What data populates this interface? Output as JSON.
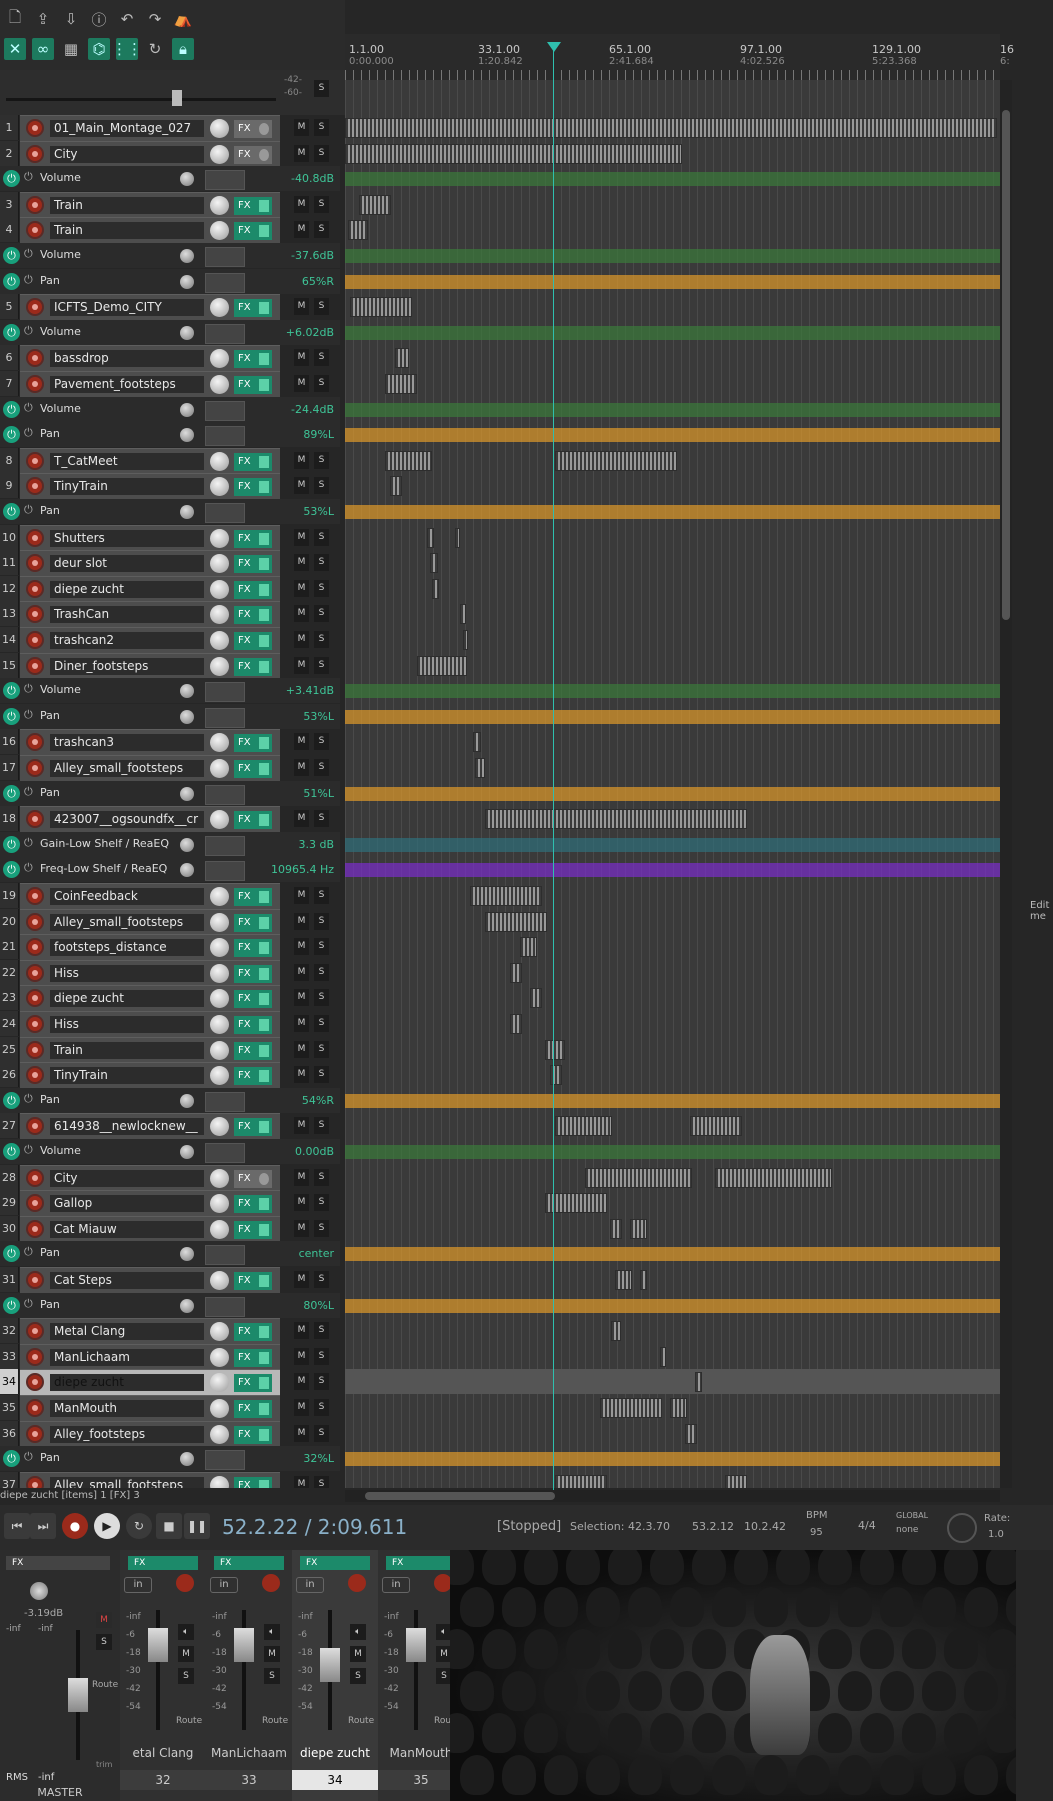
{
  "ruler": [
    {
      "bar": "1.1.00",
      "time": "0:00.000"
    },
    {
      "bar": "33.1.00",
      "time": "1:20.842"
    },
    {
      "bar": "65.1.00",
      "time": "2:41.684"
    },
    {
      "bar": "97.1.00",
      "time": "4:02.526"
    },
    {
      "bar": "129.1.00",
      "time": "5:23.368"
    },
    {
      "bar": "16",
      "time": "6:"
    }
  ],
  "tcp_top": {
    "meter_a": "-42-",
    "meter_b": "-60-",
    "s": "S"
  },
  "rows": [
    {
      "kind": "track",
      "num": "1",
      "name": "01_Main_Montage_027",
      "fx_off": true,
      "m": "M",
      "s": "S"
    },
    {
      "kind": "track",
      "num": "2",
      "name": "City",
      "fx_off": true,
      "m": "M",
      "s": "S"
    },
    {
      "kind": "env",
      "name": "Volume",
      "value": "-40.8dB"
    },
    {
      "kind": "track",
      "num": "3",
      "name": "Train",
      "m": "M",
      "s": "S"
    },
    {
      "kind": "track",
      "num": "4",
      "name": "Train",
      "m": "M",
      "s": "S"
    },
    {
      "kind": "env",
      "name": "Volume",
      "value": "-37.6dB"
    },
    {
      "kind": "env",
      "name": "Pan",
      "value": "65%R"
    },
    {
      "kind": "track",
      "num": "5",
      "name": "ICFTS_Demo_CITY",
      "m": "M",
      "s": "S"
    },
    {
      "kind": "env",
      "name": "Volume",
      "value": "+6.02dB"
    },
    {
      "kind": "track",
      "num": "6",
      "name": "bassdrop",
      "m": "M",
      "s": "S"
    },
    {
      "kind": "track",
      "num": "7",
      "name": "Pavement_footsteps",
      "m": "M",
      "s": "S"
    },
    {
      "kind": "env",
      "name": "Volume",
      "value": "-24.4dB"
    },
    {
      "kind": "env",
      "name": "Pan",
      "value": "89%L"
    },
    {
      "kind": "track",
      "num": "8",
      "name": "T_CatMeet",
      "m": "M",
      "s": "S"
    },
    {
      "kind": "track",
      "num": "9",
      "name": "TinyTrain",
      "m": "M",
      "s": "S"
    },
    {
      "kind": "env",
      "name": "Pan",
      "value": "53%L"
    },
    {
      "kind": "track",
      "num": "10",
      "name": "Shutters",
      "m": "M",
      "s": "S"
    },
    {
      "kind": "track",
      "num": "11",
      "name": "deur slot",
      "m": "M",
      "s": "S"
    },
    {
      "kind": "track",
      "num": "12",
      "name": "diepe zucht",
      "m": "M",
      "s": "S"
    },
    {
      "kind": "track",
      "num": "13",
      "name": "TrashCan",
      "m": "M",
      "s": "S"
    },
    {
      "kind": "track",
      "num": "14",
      "name": "trashcan2",
      "m": "M",
      "s": "S"
    },
    {
      "kind": "track",
      "num": "15",
      "name": "Diner_footsteps",
      "m": "M",
      "s": "S"
    },
    {
      "kind": "env",
      "name": "Volume",
      "value": "+3.41dB"
    },
    {
      "kind": "env",
      "name": "Pan",
      "value": "53%L"
    },
    {
      "kind": "track",
      "num": "16",
      "name": "trashcan3",
      "m": "M",
      "s": "S"
    },
    {
      "kind": "track",
      "num": "17",
      "name": "Alley_small_footsteps",
      "m": "M",
      "s": "S"
    },
    {
      "kind": "env",
      "name": "Pan",
      "value": "51%L"
    },
    {
      "kind": "track",
      "num": "18",
      "name": "423007__ogsoundfx__cr",
      "m": "M",
      "s": "S"
    },
    {
      "kind": "env",
      "name": "Gain-Low Shelf / ReaEQ",
      "value": "3.3 dB"
    },
    {
      "kind": "env",
      "name": "Freq-Low Shelf / ReaEQ",
      "value": "10965.4 Hz"
    },
    {
      "kind": "track",
      "num": "19",
      "name": "CoinFeedback",
      "m": "M",
      "s": "S"
    },
    {
      "kind": "track",
      "num": "20",
      "name": "Alley_small_footsteps",
      "m": "M",
      "s": "S"
    },
    {
      "kind": "track",
      "num": "21",
      "name": "footsteps_distance",
      "m": "M",
      "s": "S"
    },
    {
      "kind": "track",
      "num": "22",
      "name": "Hiss",
      "m": "M",
      "s": "S"
    },
    {
      "kind": "track",
      "num": "23",
      "name": "diepe zucht",
      "m": "M",
      "s": "S"
    },
    {
      "kind": "track",
      "num": "24",
      "name": "Hiss",
      "m": "M",
      "s": "S"
    },
    {
      "kind": "track",
      "num": "25",
      "name": "Train",
      "m": "M",
      "s": "S"
    },
    {
      "kind": "track",
      "num": "26",
      "name": "TinyTrain",
      "m": "M",
      "s": "S"
    },
    {
      "kind": "env",
      "name": "Pan",
      "value": "54%R"
    },
    {
      "kind": "track",
      "num": "27",
      "name": "614938__newlocknew__",
      "m": "M",
      "s": "S"
    },
    {
      "kind": "env",
      "name": "Volume",
      "value": "0.00dB"
    },
    {
      "kind": "track",
      "num": "28",
      "name": "City",
      "fx_off": true,
      "m": "M",
      "s": "S"
    },
    {
      "kind": "track",
      "num": "29",
      "name": "Gallop",
      "m": "M",
      "s": "S"
    },
    {
      "kind": "track",
      "num": "30",
      "name": "Cat Miauw",
      "m": "M",
      "s": "S"
    },
    {
      "kind": "env",
      "name": "Pan",
      "value": "center"
    },
    {
      "kind": "track",
      "num": "31",
      "name": "Cat Steps",
      "m": "M",
      "s": "S"
    },
    {
      "kind": "env",
      "name": "Pan",
      "value": "80%L"
    },
    {
      "kind": "track",
      "num": "32",
      "name": "Metal Clang",
      "m": "M",
      "s": "S"
    },
    {
      "kind": "track",
      "num": "33",
      "name": "ManLichaam",
      "m": "M",
      "s": "S"
    },
    {
      "kind": "track",
      "num": "34",
      "name": "diepe zucht",
      "selected": true,
      "m": "M",
      "s": "S"
    },
    {
      "kind": "track",
      "num": "35",
      "name": "ManMouth",
      "m": "M",
      "s": "S"
    },
    {
      "kind": "track",
      "num": "36",
      "name": "Alley_footsteps",
      "m": "M",
      "s": "S"
    },
    {
      "kind": "env",
      "name": "Pan",
      "value": "32%L"
    },
    {
      "kind": "track",
      "num": "37",
      "name": "Alley_small_footsteps",
      "m": "M",
      "s": "S"
    }
  ],
  "status_line": "diepe zucht [items] 1 [FX] 3",
  "transport": {
    "time": "52.2.22 / 2:09.611",
    "state": "[Stopped]",
    "selection_label": "Selection:",
    "sel_start": "42.3.70",
    "sel_end": "53.2.12",
    "sel_len": "10.2.42",
    "bpm_label": "BPM",
    "bpm": "95",
    "timesig": "4/4",
    "global": "GLOBAL",
    "none": "none",
    "rate_label": "Rate:",
    "rate": "1.0"
  },
  "mixer": {
    "master": {
      "label": "MASTER",
      "rms": "RMS",
      "inf": "-inf",
      "db": "-3.19dB",
      "fx": "FX",
      "trim": "trim",
      "route": "Route"
    },
    "strips": [
      {
        "name": "etal Clang",
        "num": "32",
        "fx": "FX",
        "in": "in"
      },
      {
        "name": "ManLichaam",
        "num": "33",
        "fx": "FX",
        "in": "in"
      },
      {
        "name": "diepe zucht",
        "num": "34",
        "fx": "FX",
        "in": "in",
        "selected": true
      },
      {
        "name": "ManMouth",
        "num": "35",
        "fx": "FX",
        "in": "in"
      }
    ],
    "meter_scale": [
      "-inf",
      "-6",
      "-18",
      "-30",
      "-42",
      "-54"
    ],
    "m": "M",
    "s": "S",
    "route": "Route"
  },
  "side_text": "Edit me",
  "colors": {
    "accent": "#1c8a6a",
    "playhead": "#2fbfae",
    "pan_env": "#e09a2a",
    "vol_env": "#3a7a3a",
    "freq_env": "#7b2ccc",
    "rec": "#9b2a1b"
  }
}
